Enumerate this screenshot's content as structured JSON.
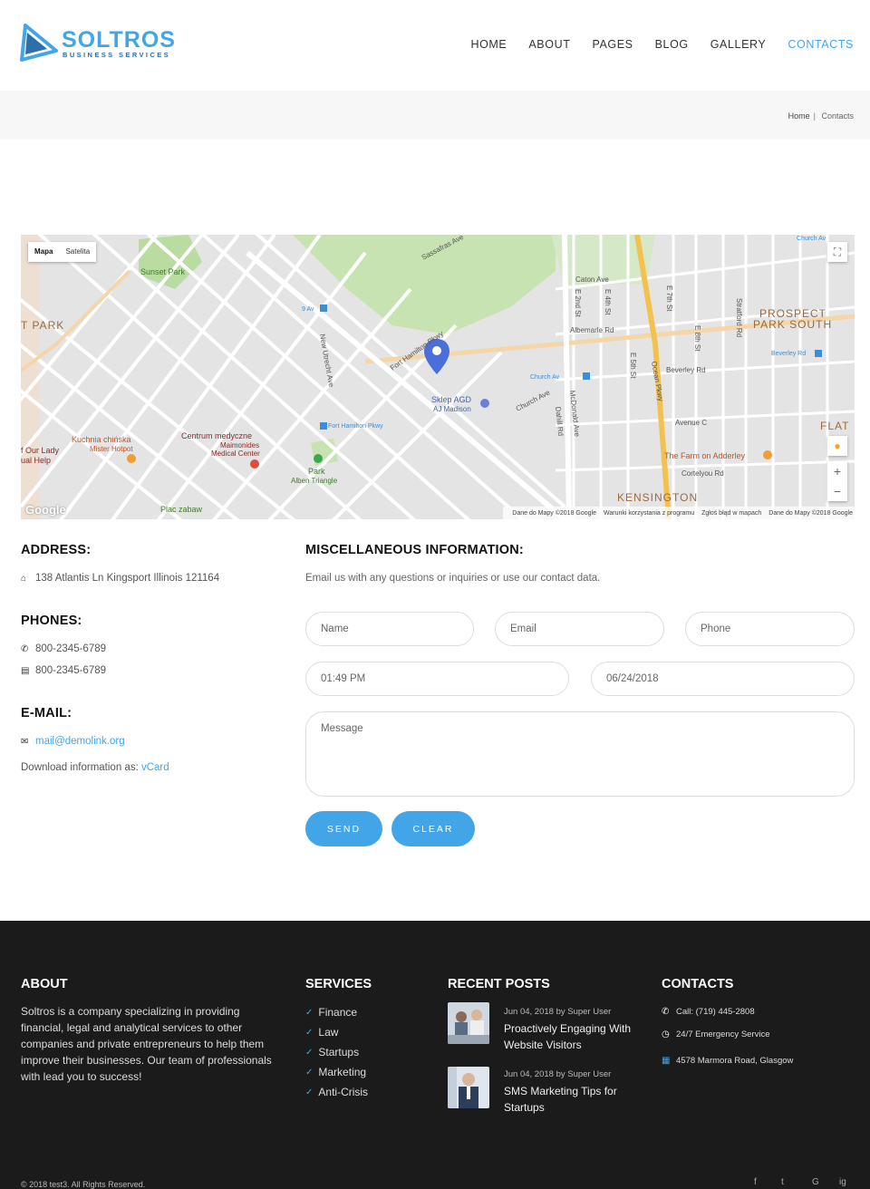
{
  "brand": {
    "name": "SOLTROS",
    "tagline": "BUSINESS SERVICES",
    "accent": "#42a5e8"
  },
  "nav": {
    "items": [
      "HOME",
      "ABOUT",
      "PAGES",
      "BLOG",
      "GALLERY",
      "CONTACTS"
    ],
    "active": "CONTACTS"
  },
  "breadcrumb": {
    "home": "Home",
    "separator": "|",
    "current": "Contacts"
  },
  "map": {
    "type_map": "Mapa",
    "type_satellite": "Satelita",
    "google": "Google",
    "attribution": [
      "Dane do Mapy ©2018 Google",
      "Warunki korzystania z programu",
      "Zgłoś błąd w mapach",
      "Dane do Mapy ©2018 Google"
    ],
    "labels": {
      "sunset_park": "Sunset Park",
      "park_slope": "T PARK",
      "prospect": "PROSPECT",
      "park_south": "PARK SOUTH",
      "kensington": "KENSINGTON",
      "flat": "FLAT",
      "kuchnia": "Kuchnia chińska",
      "hotpot": "Mister Hotpot",
      "centrum": "Centrum medyczne",
      "maimonides": "Maimonides",
      "medical": "Medical Center",
      "park": "Park",
      "alben": "Alben Triangle",
      "sklep": "Sklep AGD",
      "aj": "AJ Madison",
      "farm": "The Farm on Adderley",
      "our_lady": "f Our Lady",
      "help": "ual Help",
      "plac": "Plac zabaw",
      "fort_ham": "Fort Hamilton Pkwy",
      "church_av": "Church Av",
      "beverley_rd": "Beverley Rd",
      "nine_av": "9 Av",
      "ocean": "Ocean Pkwy",
      "caton": "Caton Ave",
      "albemarle": "Albemarle Rd",
      "beverley": "Beverley Rd",
      "avenue_c": "Avenue C",
      "cortelyou": "Cortelyou Rd",
      "church_ave": "Church Ave",
      "fort_ham_pkwy": "Fort Hamilton Pkwy",
      "new_utrecht": "New Utrecht Ave",
      "mcdonald": "McDonald Ave",
      "dahill": "Dahill Rd",
      "sassafras": "Sassafras Ave",
      "e_2nd": "E 2nd St",
      "e_4th": "E 4th St",
      "e_5th": "E 5th St",
      "e_7th": "E 7th St",
      "e_8th": "E 8th St",
      "stratford": "Stratford Rd",
      "church_av_top": "Church Av"
    }
  },
  "address": {
    "heading": "ADDRESS:",
    "value": "138 Atlantis Ln Kingsport Illinois 121164"
  },
  "phones": {
    "heading": "PHONES:",
    "phone": "800-2345-6789",
    "fax": "800-2345-6789"
  },
  "email": {
    "heading": "E-MAIL:",
    "value": "mail@demolink.org",
    "download_text": "Download information as:",
    "vcard": "vCard"
  },
  "misc": {
    "heading": "MISCELLANEOUS INFORMATION:",
    "description": "Email us with any questions or inquiries or use our contact data."
  },
  "form": {
    "name_placeholder": "Name",
    "email_placeholder": "Email",
    "phone_placeholder": "Phone",
    "time_value": "01:49 PM",
    "date_value": "06/24/2018",
    "message_placeholder": "Message",
    "send_label": "SEND",
    "clear_label": "CLEAR"
  },
  "footer": {
    "about": {
      "heading": "ABOUT",
      "text": "Soltros is a company specializing in providing financial, legal and analytical services to other companies and private entrepreneurs to help them improve their businesses. Our team of professionals with lead you to success!"
    },
    "services": {
      "heading": "SERVICES",
      "items": [
        "Finance",
        "Law",
        "Startups",
        "Marketing",
        "Anti-Crisis"
      ]
    },
    "recent_posts": {
      "heading": "RECENT POSTS",
      "posts": [
        {
          "meta": "Jun 04, 2018 by Super User",
          "title": "Proactively Engaging With Website Visitors"
        },
        {
          "meta": "Jun 04, 2018 by Super User",
          "title": "SMS Marketing Tips for Startups"
        }
      ]
    },
    "contacts": {
      "heading": "CONTACTS",
      "call": "Call: (719) 445-2808",
      "emergency": "24/7 Emergency Service",
      "address": "4578 Marmora Road, Glasgow"
    },
    "copyright": "© 2018 test3. All Rights Reserved.",
    "social": [
      "f",
      "t",
      "G",
      "ig"
    ]
  }
}
